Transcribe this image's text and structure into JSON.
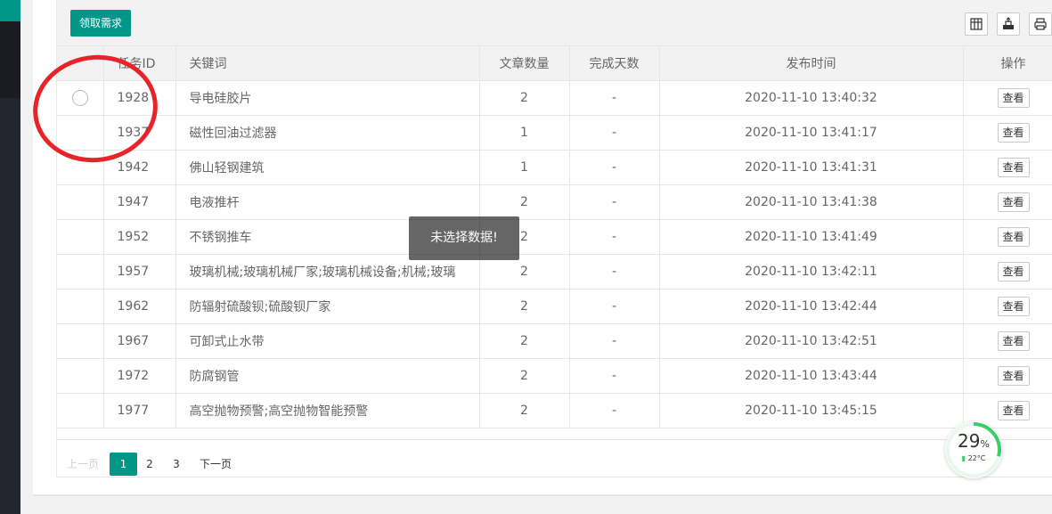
{
  "toolbar": {
    "claim_label": "领取需求",
    "icons": [
      "columns-icon",
      "export-icon",
      "print-icon"
    ]
  },
  "table": {
    "headers": {
      "id": "任务ID",
      "keyword": "关键词",
      "count": "文章数量",
      "days": "完成天数",
      "time": "发布时间",
      "op": "操作"
    },
    "rows": [
      {
        "id": "1928",
        "keyword": "导电硅胶片",
        "count": "2",
        "days": "-",
        "time": "2020-11-10 13:40:32",
        "op": "查看"
      },
      {
        "id": "1937",
        "keyword": "磁性回油过滤器",
        "count": "1",
        "days": "-",
        "time": "2020-11-10 13:41:17",
        "op": "查看"
      },
      {
        "id": "1942",
        "keyword": "佛山轻钢建筑",
        "count": "1",
        "days": "-",
        "time": "2020-11-10 13:41:31",
        "op": "查看"
      },
      {
        "id": "1947",
        "keyword": "电液推杆",
        "count": "2",
        "days": "-",
        "time": "2020-11-10 13:41:38",
        "op": "查看"
      },
      {
        "id": "1952",
        "keyword": "不锈钢推车",
        "count": "2",
        "days": "-",
        "time": "2020-11-10 13:41:49",
        "op": "查看"
      },
      {
        "id": "1957",
        "keyword": "玻璃机械;玻璃机械厂家;玻璃机械设备;机械;玻璃",
        "count": "2",
        "days": "-",
        "time": "2020-11-10 13:42:11",
        "op": "查看"
      },
      {
        "id": "1962",
        "keyword": "防辐射硫酸钡;硫酸钡厂家",
        "count": "2",
        "days": "-",
        "time": "2020-11-10 13:42:44",
        "op": "查看"
      },
      {
        "id": "1967",
        "keyword": "可卸式止水带",
        "count": "2",
        "days": "-",
        "time": "2020-11-10 13:42:51",
        "op": "查看"
      },
      {
        "id": "1972",
        "keyword": "防腐钢管",
        "count": "2",
        "days": "-",
        "time": "2020-11-10 13:43:44",
        "op": "查看"
      },
      {
        "id": "1977",
        "keyword": "高空抛物预警;高空抛物智能预警",
        "count": "2",
        "days": "-",
        "time": "2020-11-10 13:45:15",
        "op": "查看"
      }
    ]
  },
  "pager": {
    "prev": "上一页",
    "pages": [
      "1",
      "2",
      "3"
    ],
    "current": "1",
    "next": "下一页"
  },
  "toast": "未选择数据!",
  "widget": {
    "percent": "29",
    "percent_sign": "%",
    "temperature": "22°C",
    "percent_value": 0.29
  },
  "colors": {
    "primary": "#009688",
    "sidebar": "#23262e",
    "annotation": "#e8242b"
  }
}
